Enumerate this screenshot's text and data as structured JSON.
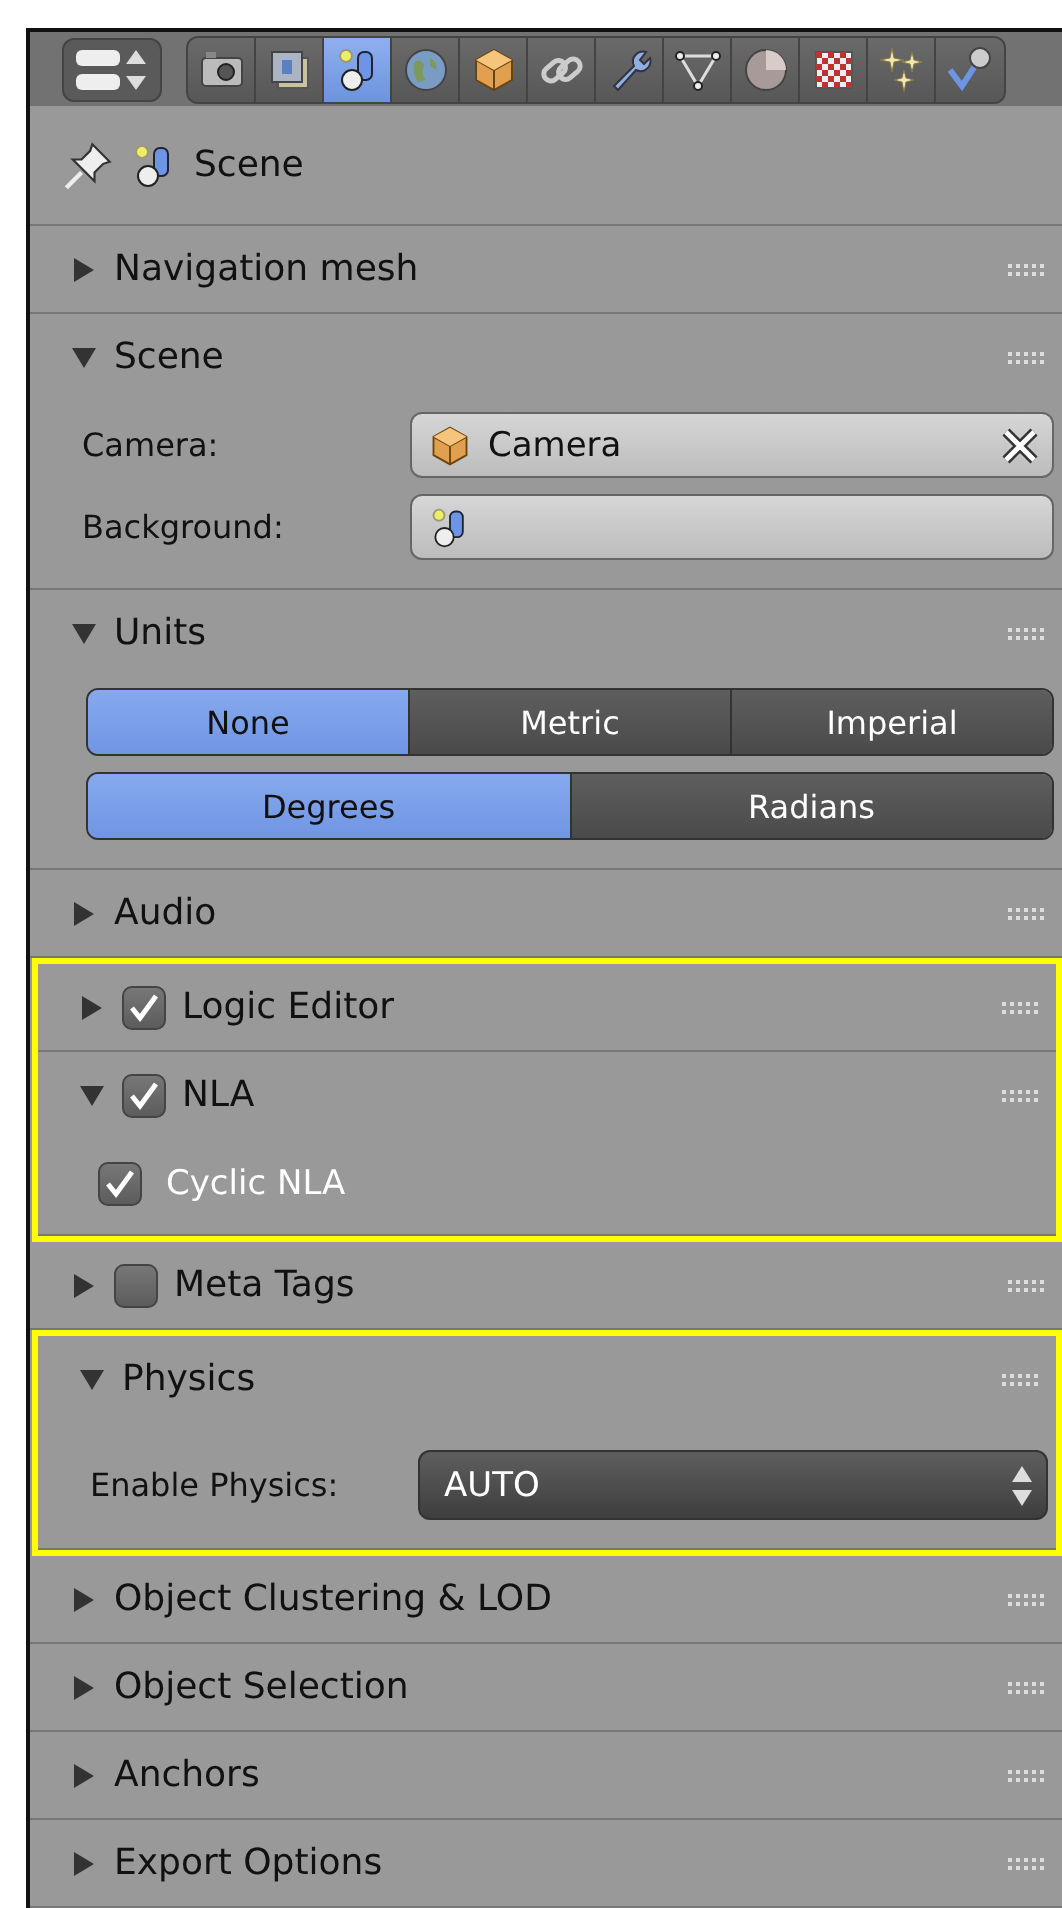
{
  "toolbar": {
    "tabs": [
      {
        "kind": "camera",
        "selected": false
      },
      {
        "kind": "image",
        "selected": false
      },
      {
        "kind": "scene",
        "selected": true
      },
      {
        "kind": "globe",
        "selected": false
      },
      {
        "kind": "cube",
        "selected": false
      },
      {
        "kind": "link",
        "selected": false
      },
      {
        "kind": "wrench",
        "selected": false
      },
      {
        "kind": "triangle",
        "selected": false
      },
      {
        "kind": "sphere",
        "selected": false
      },
      {
        "kind": "checker",
        "selected": false
      },
      {
        "kind": "sparkle",
        "selected": false
      },
      {
        "kind": "checksphere",
        "selected": false
      }
    ]
  },
  "context": {
    "label": "Scene"
  },
  "panels": [
    {
      "title": "Navigation mesh",
      "expanded": false,
      "highlighted": false
    },
    {
      "title": "Scene",
      "expanded": true,
      "highlighted": false,
      "content": [
        {
          "kind": "field",
          "label": "Camera:",
          "value": "Camera",
          "clearable": true
        },
        {
          "kind": "field",
          "label": "Background:",
          "clearable": false
        }
      ]
    },
    {
      "title": "Units",
      "expanded": true,
      "highlighted": false,
      "content": [
        {
          "kind": "segmented",
          "options": [
            {
              "label": "None",
              "selected": true
            },
            {
              "label": "Metric",
              "selected": false
            },
            {
              "label": "Imperial",
              "selected": false
            }
          ]
        },
        {
          "kind": "segmented",
          "options": [
            {
              "label": "Degrees",
              "selected": true
            },
            {
              "label": "Radians",
              "selected": false
            }
          ]
        }
      ]
    },
    {
      "title": "Audio",
      "expanded": false,
      "highlighted": false
    },
    {
      "title": "Logic Editor",
      "expanded": false,
      "checked": true,
      "highlighted": true
    },
    {
      "title": "NLA",
      "expanded": true,
      "checked": true,
      "highlighted": true,
      "content": [
        {
          "kind": "checkbox",
          "label": "Cyclic NLA",
          "checked": true
        }
      ]
    },
    {
      "title": "Meta Tags",
      "expanded": false,
      "checked": false,
      "highlighted": false
    },
    {
      "title": "Physics",
      "expanded": true,
      "highlighted": true,
      "content": [
        {
          "kind": "dropdown",
          "label": "Enable Physics:",
          "value": "AUTO"
        }
      ]
    },
    {
      "title": "Object Clustering & LOD",
      "expanded": false,
      "highlighted": false
    },
    {
      "title": "Object Selection",
      "expanded": false,
      "highlighted": false
    },
    {
      "title": "Anchors",
      "expanded": false,
      "highlighted": false
    },
    {
      "title": "Export Options",
      "expanded": false,
      "highlighted": false
    }
  ]
}
